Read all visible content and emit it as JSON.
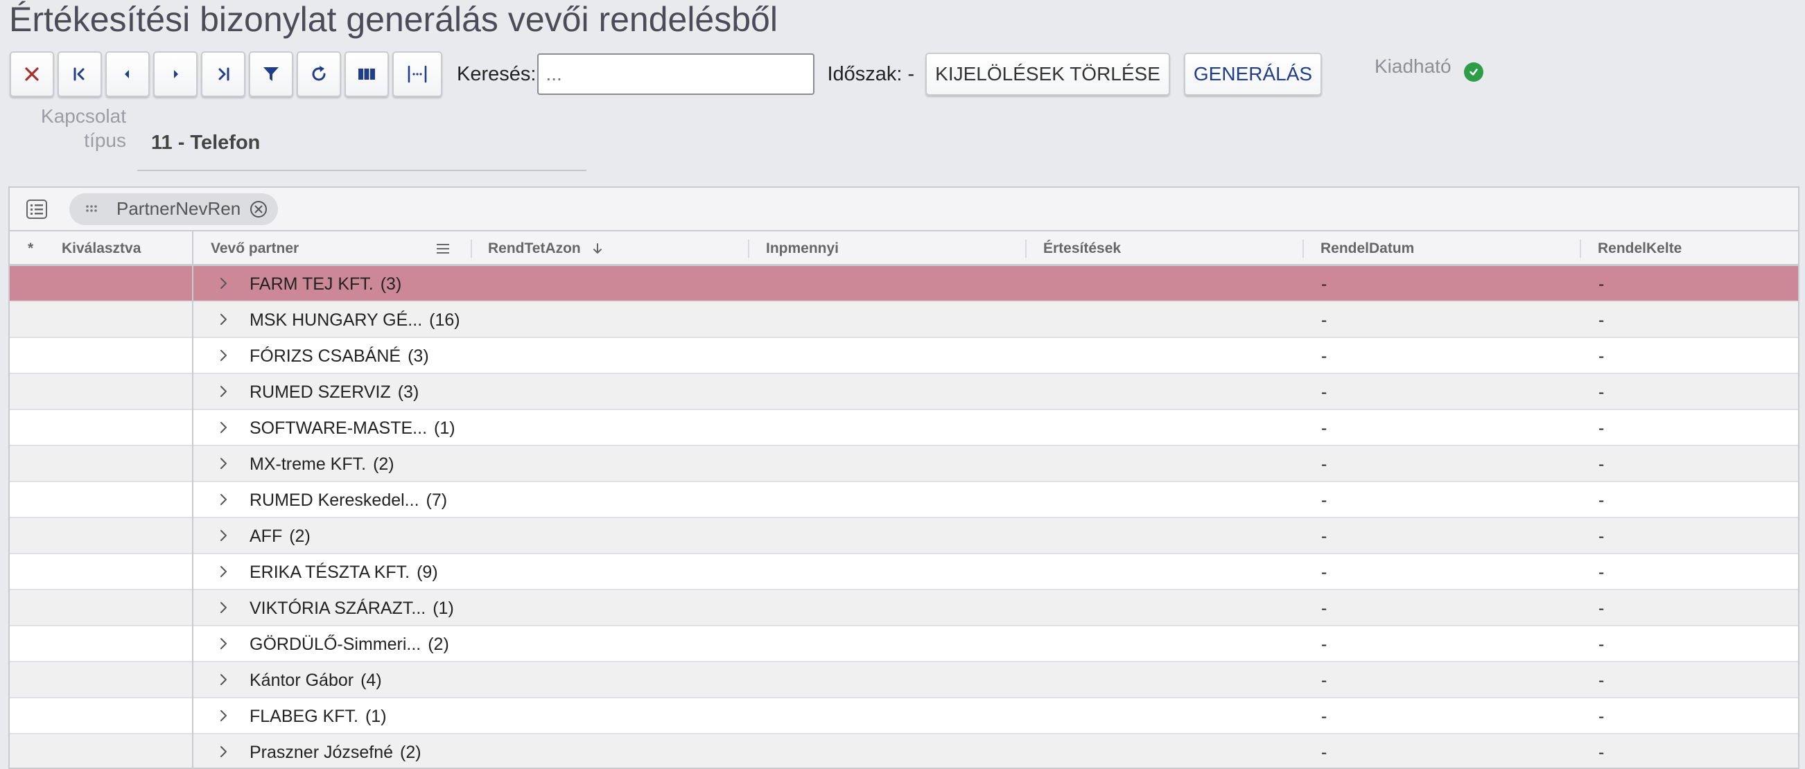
{
  "page": {
    "title": "Értékesítési bizonylat generálás vevői rendelésből"
  },
  "toolbar": {
    "icons": [
      "close-icon",
      "first-page-icon",
      "previous-icon",
      "next-icon",
      "last-page-icon",
      "filter-icon",
      "refresh-icon",
      "columns-icon",
      "fit-columns-icon"
    ],
    "search_label": "Keresés:",
    "search_placeholder": "...",
    "period_label": "Időszak: -",
    "clear_selection_label": "KIJELÖLÉSEK TÖRLÉSE",
    "generate_label": "GENERÁLÁS"
  },
  "status": {
    "label": "Kiadható",
    "color": "#2e9d48"
  },
  "filter": {
    "label": "Kapcsolat típus",
    "value": "11 - Telefon"
  },
  "grid": {
    "group_chip": "PartnerNevRen",
    "columns": {
      "star": "*",
      "selected": "Kiválasztva",
      "partner": "Vevő partner",
      "order_id": "RendTetAzon",
      "quantity": "Inpmennyi",
      "notifications": "Értesítések",
      "order_date": "RendelDatum",
      "order_issued": "RendelKelte"
    },
    "selected_row_color": "#cd8898",
    "rows": [
      {
        "name": "FARM TEJ KFT.",
        "count": "(3)",
        "d1": "-",
        "d2": "-"
      },
      {
        "name": "MSK HUNGARY GÉ...",
        "count": "(16)",
        "d1": "-",
        "d2": "-"
      },
      {
        "name": "FÓRIZS CSABÁNÉ",
        "count": "(3)",
        "d1": "-",
        "d2": "-"
      },
      {
        "name": "RUMED SZERVIZ",
        "count": "(3)",
        "d1": "-",
        "d2": "-"
      },
      {
        "name": "SOFTWARE-MASTE...",
        "count": "(1)",
        "d1": "-",
        "d2": "-"
      },
      {
        "name": "MX-treme KFT.",
        "count": "(2)",
        "d1": "-",
        "d2": "-"
      },
      {
        "name": "RUMED Kereskedel...",
        "count": "(7)",
        "d1": "-",
        "d2": "-"
      },
      {
        "name": "AFF",
        "count": "(2)",
        "d1": "-",
        "d2": "-"
      },
      {
        "name": "ERIKA TÉSZTA KFT.",
        "count": "(9)",
        "d1": "-",
        "d2": "-"
      },
      {
        "name": "VIKTÓRIA SZÁRAZT...",
        "count": "(1)",
        "d1": "-",
        "d2": "-"
      },
      {
        "name": "GÖRDÜLŐ-Simmeri...",
        "count": "(2)",
        "d1": "-",
        "d2": "-"
      },
      {
        "name": "Kántor Gábor",
        "count": "(4)",
        "d1": "-",
        "d2": "-"
      },
      {
        "name": "FLABEG KFT.",
        "count": "(1)",
        "d1": "-",
        "d2": "-"
      },
      {
        "name": "Praszner Józsefné",
        "count": "(2)",
        "d1": "-",
        "d2": "-"
      }
    ]
  }
}
